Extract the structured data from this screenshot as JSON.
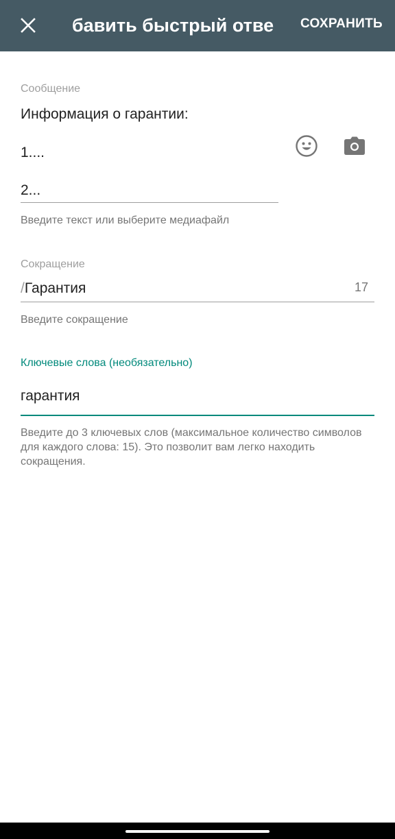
{
  "appbar": {
    "title": "бавить быстрый отве",
    "save_label": "СОХРАНИТЬ",
    "background": "#455a64"
  },
  "message": {
    "label": "Сообщение",
    "lines": [
      "Информация о гарантии:",
      "1....",
      "2..."
    ],
    "hint": "Введите текст или выберите медиафайл"
  },
  "shortcut": {
    "label": "Сокращение",
    "prefix": "/",
    "value": "Гарантия",
    "counter": "17",
    "hint": "Введите сокращение"
  },
  "keywords": {
    "label": "Ключевые слова (необязательно)",
    "value": "гарантия",
    "hint": "Введите до 3 ключевых слов (максимальное количество символов для каждого слова: 15). Это позволит вам легко находить сокращения.",
    "accent": "#00897b"
  },
  "icons": [
    "close-icon",
    "emoji-icon",
    "camera-icon"
  ]
}
